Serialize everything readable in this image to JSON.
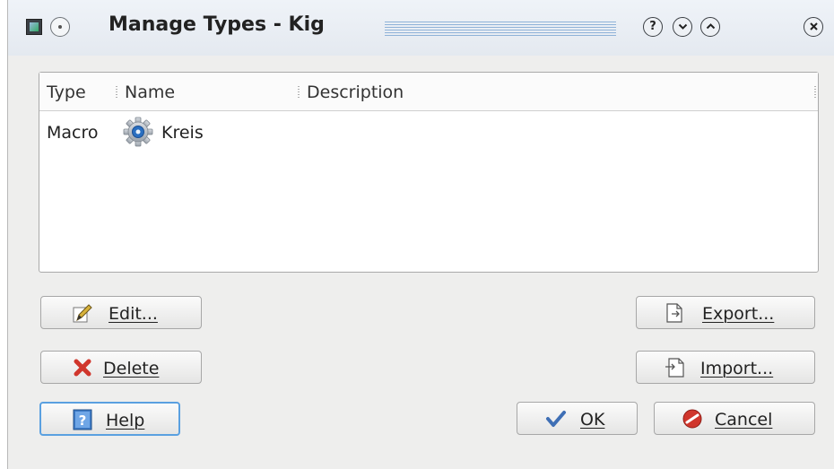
{
  "window": {
    "title": "Manage Types - Kig"
  },
  "titlebar": {
    "app_icon": "kig-app-icon",
    "menu_icon": "window-menu-icon",
    "help_symbol": "?",
    "help_icon": "help-circle-icon",
    "minimize_icon": "chevron-down-circle-icon",
    "maximize_icon": "chevron-up-circle-icon",
    "close_icon": "close-circle-icon"
  },
  "list": {
    "columns": [
      "Type",
      "Name",
      "Description"
    ],
    "rows": [
      {
        "type": "Macro",
        "icon": "gear-icon",
        "name": "Kreis",
        "description": ""
      }
    ]
  },
  "buttons": {
    "edit": {
      "label": "Edit...",
      "icon": "pencil-icon"
    },
    "delete": {
      "label": "Delete",
      "icon": "red-x-icon"
    },
    "help": {
      "label": "Help",
      "icon": "help-book-icon"
    },
    "export": {
      "label": "Export...",
      "icon": "export-document-icon"
    },
    "import": {
      "label": "Import...",
      "icon": "import-document-icon"
    },
    "ok": {
      "label": "OK",
      "icon": "checkmark-icon"
    },
    "cancel": {
      "label": "Cancel",
      "icon": "cancel-icon"
    }
  },
  "colors": {
    "titlebar_accent": "#8fb2d8",
    "focus_border": "#5aa0e0",
    "cancel_red": "#d0362c",
    "help_blue": "#3f7cc8"
  }
}
